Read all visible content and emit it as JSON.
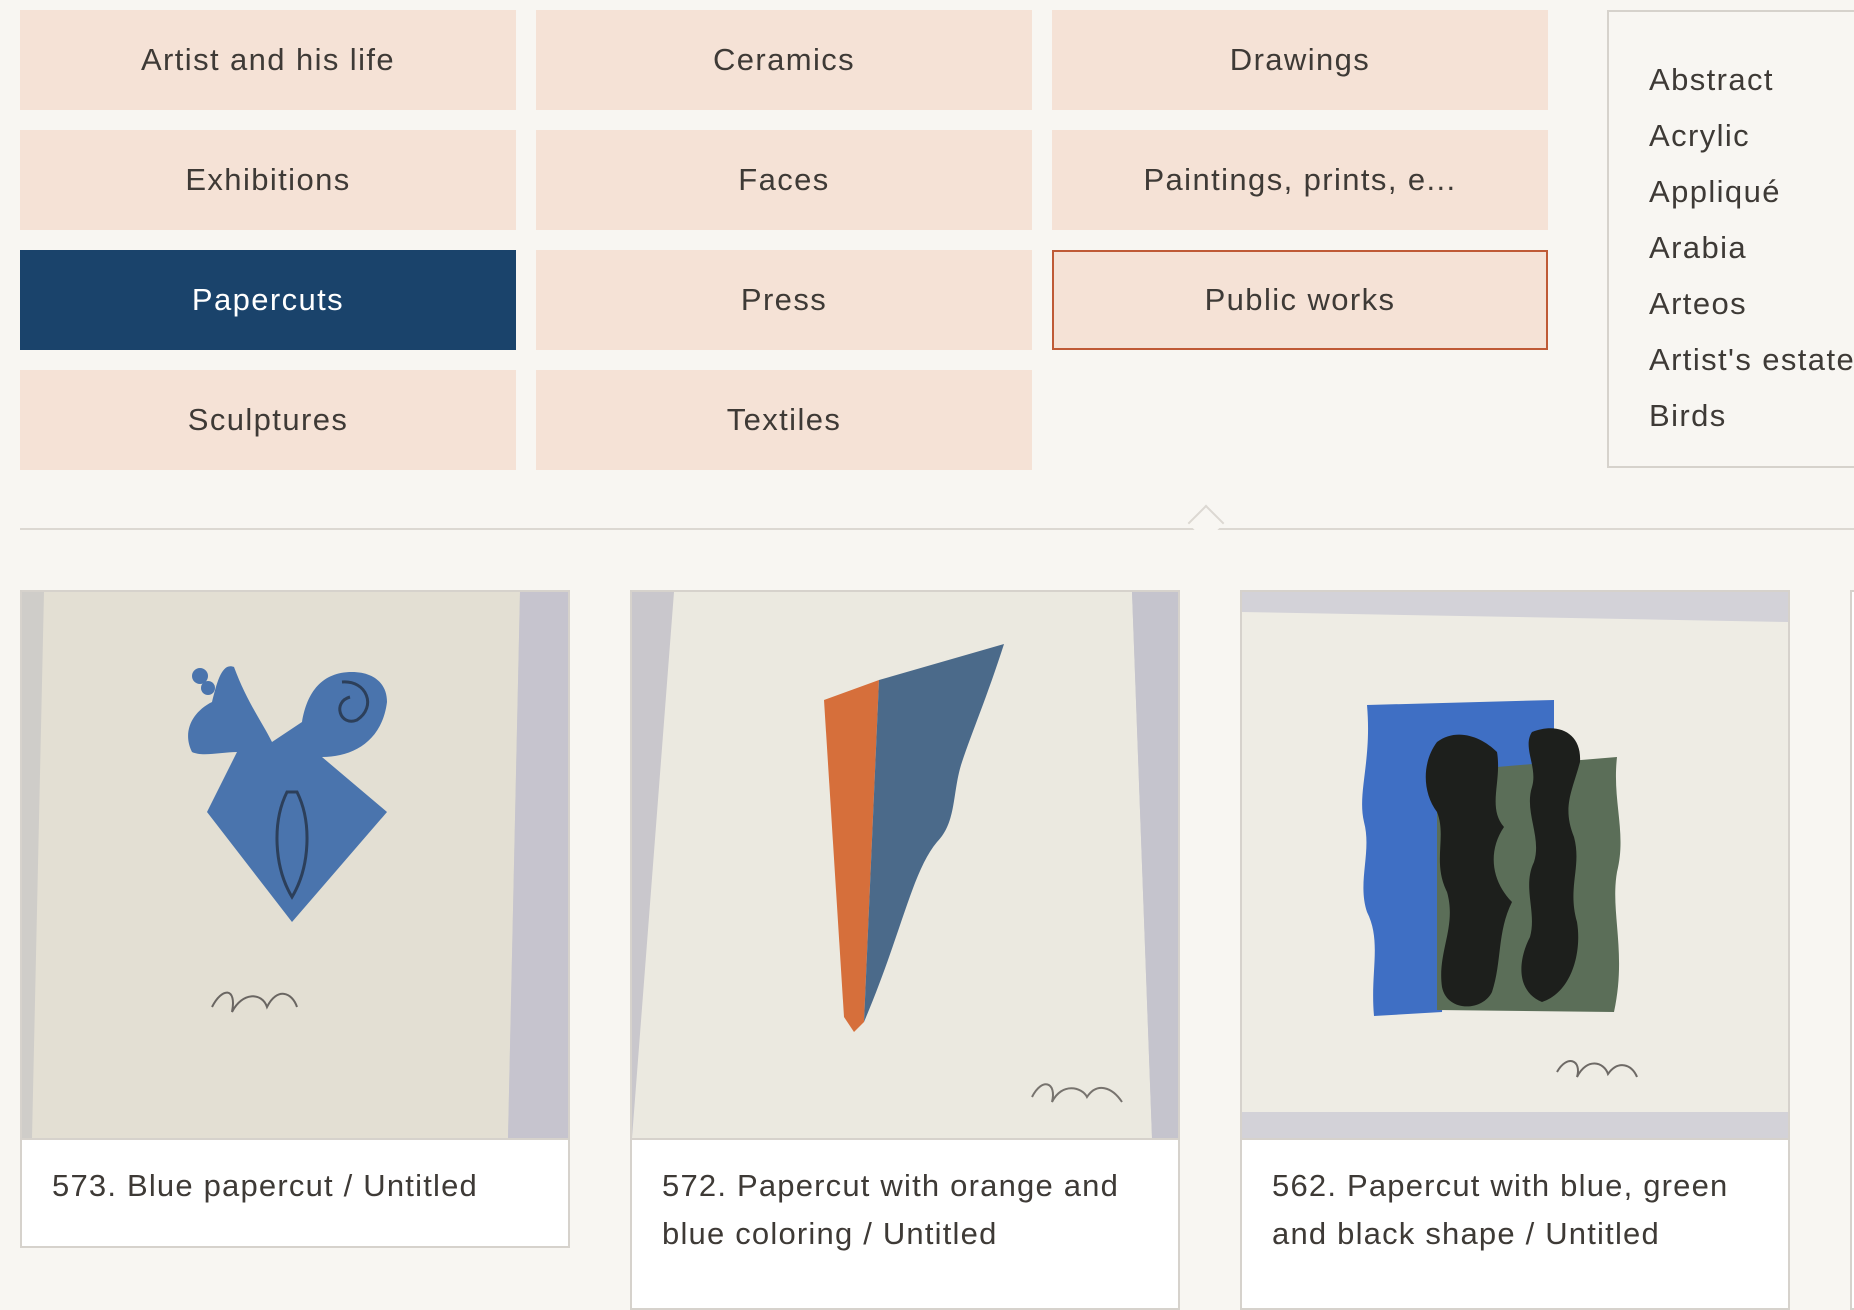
{
  "categories": [
    {
      "label": "Artist and his life"
    },
    {
      "label": "Ceramics"
    },
    {
      "label": "Drawings"
    },
    {
      "label": "Exhibitions"
    },
    {
      "label": "Faces"
    },
    {
      "label": "Paintings, prints, e..."
    },
    {
      "label": "Papercuts"
    },
    {
      "label": "Press"
    },
    {
      "label": "Public works"
    },
    {
      "label": "Sculptures"
    },
    {
      "label": "Textiles"
    }
  ],
  "active_category": "Papercuts",
  "hover_category": "Public works",
  "tags": [
    "Abstract",
    "Acrylic",
    "Appliqué",
    "Arabia",
    "Arteos",
    "Artist's estate",
    "Birds"
  ],
  "results": [
    {
      "caption": "573. Blue papercut / Untitled",
      "image": "blue-papercut-artwork"
    },
    {
      "caption": "572. Papercut with orange and blue coloring / Untitled",
      "image": "orange-blue-papercut-artwork"
    },
    {
      "caption": "562. Papercut with blue, green and black shape / Untitled",
      "image": "blue-green-black-papercut-artwork"
    }
  ],
  "colors": {
    "page_bg": "#f8f6f2",
    "button_bg": "#f5e2d6",
    "active_bg": "#1a436b",
    "hover_border": "#bf5a36",
    "text": "#3e3a36"
  }
}
